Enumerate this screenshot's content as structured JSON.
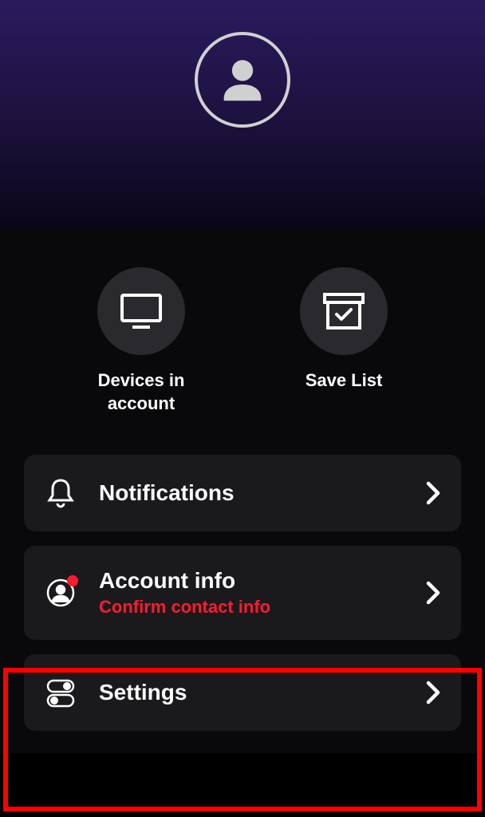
{
  "quickActions": {
    "devices": {
      "label": "Devices in account"
    },
    "saveList": {
      "label": "Save List"
    }
  },
  "listItems": {
    "notifications": {
      "title": "Notifications"
    },
    "accountInfo": {
      "title": "Account info",
      "subtitle": "Confirm contact info"
    },
    "settings": {
      "title": "Settings"
    }
  }
}
